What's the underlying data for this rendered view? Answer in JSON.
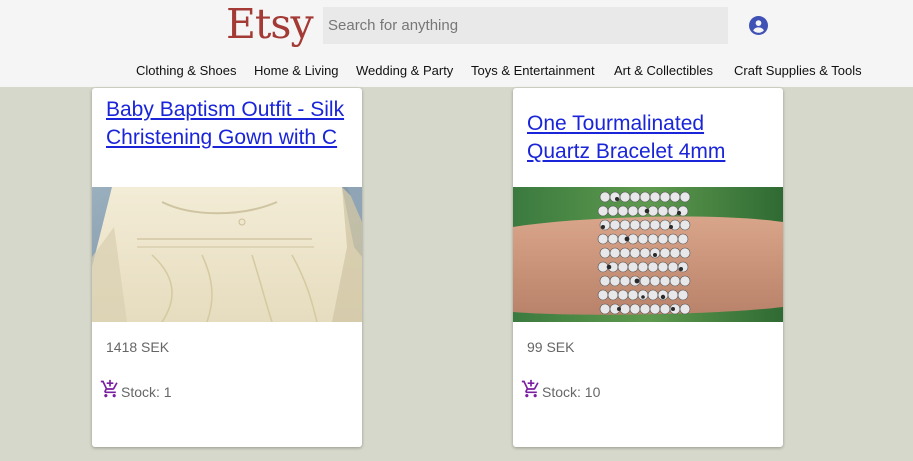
{
  "header": {
    "logo": "Etsy",
    "search_placeholder": "Search for anything",
    "account_icon": "account-circle-icon"
  },
  "nav": {
    "items": [
      {
        "label": "Clothing & Shoes"
      },
      {
        "label": "Home & Living"
      },
      {
        "label": "Wedding & Party"
      },
      {
        "label": "Toys & Entertainment"
      },
      {
        "label": "Art & Collectibles"
      },
      {
        "label": "Craft Supplies & Tools"
      }
    ]
  },
  "products": [
    {
      "title": "Baby Baptism Outfit - Silk Christening Gown with C",
      "price": "1418 SEK",
      "stock": "Stock: 1",
      "image": "christening-gown-photo",
      "cart_icon": "add-shopping-cart-icon"
    },
    {
      "title": "One Tourmalinated Quartz Bracelet 4mm",
      "price": "99 SEK",
      "stock": "Stock: 10",
      "image": "quartz-bracelet-photo",
      "cart_icon": "add-shopping-cart-icon"
    }
  ],
  "colors": {
    "logo": "#a33a35",
    "link": "#1a25d9",
    "background": "#d6d8cb",
    "header": "#f5f5f5",
    "cart_icon": "#7b1fa2",
    "account_icon": "#3f51b5"
  }
}
